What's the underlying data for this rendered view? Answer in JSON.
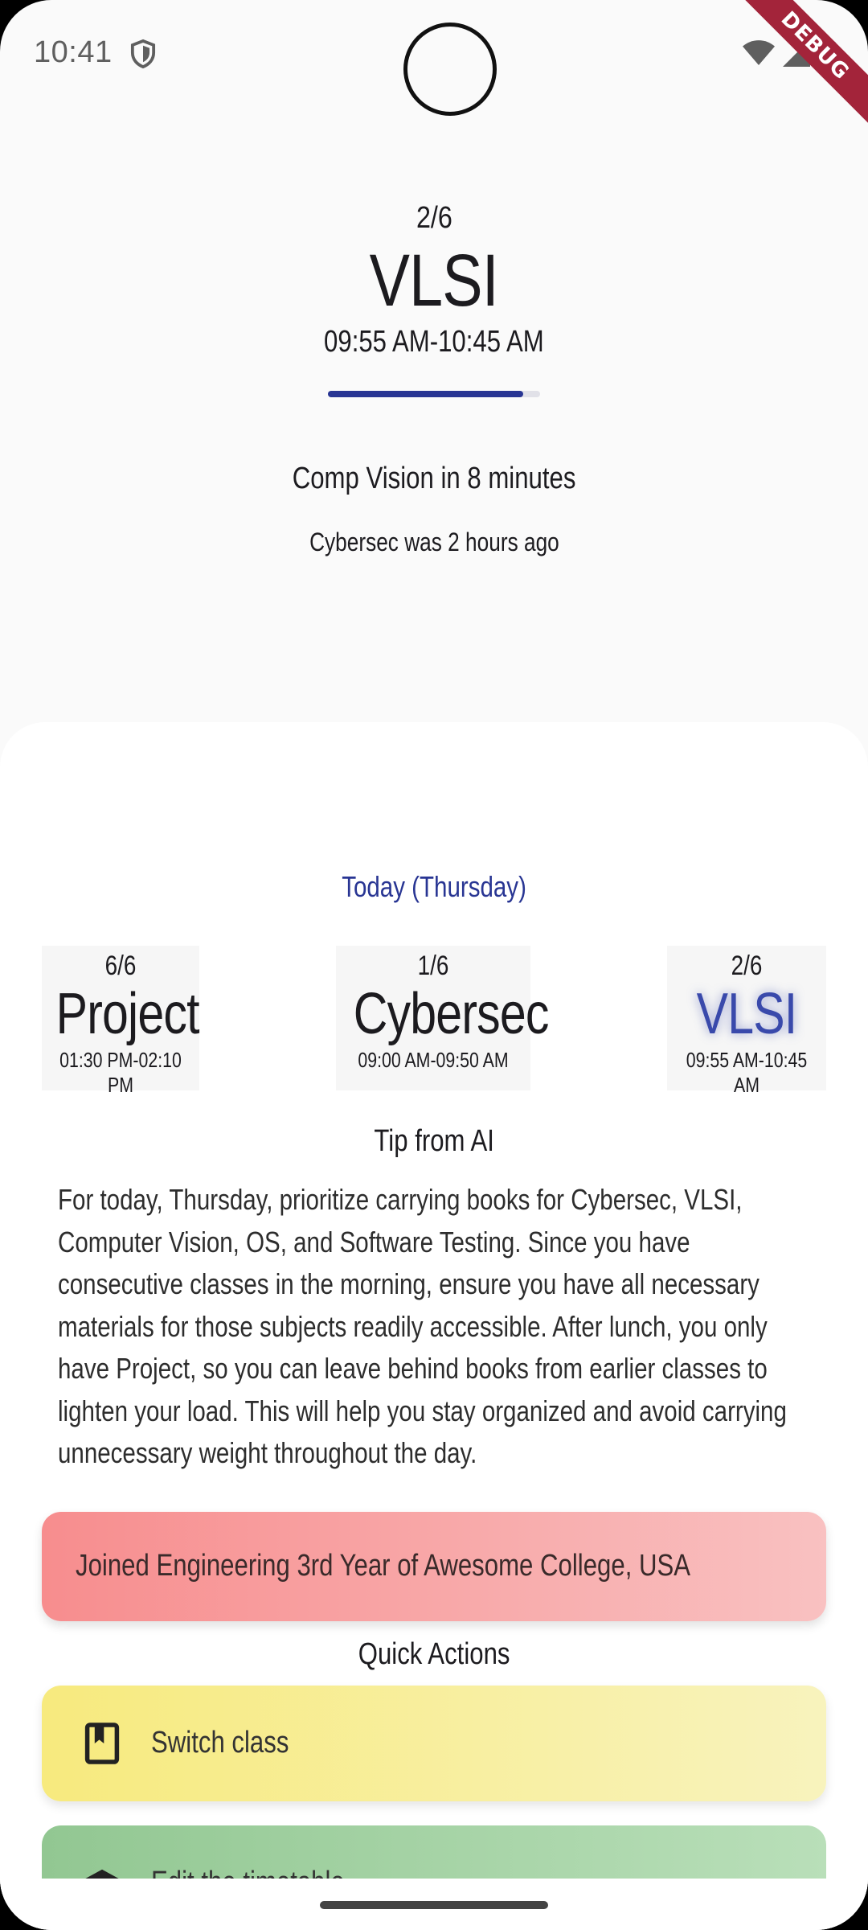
{
  "status_bar": {
    "time": "10:41",
    "debug_label": "DEBUG",
    "icons": [
      "shield-icon",
      "wifi-icon",
      "signal-icon",
      "battery-icon"
    ]
  },
  "current_class": {
    "count": "2/6",
    "name": "VLSI",
    "time": "09:55 AM-10:45 AM",
    "progress": 0.92
  },
  "upcoming": {
    "next": "Comp Vision in 8 minutes",
    "previous": "Cybersec was 2 hours ago"
  },
  "today": {
    "label": "Today (Thursday)",
    "classes": [
      {
        "count": "6/6",
        "name": "Project",
        "time": "01:30 PM-02:10 PM"
      },
      {
        "count": "1/6",
        "name": "Cybersec",
        "time": "09:00 AM-09:50 AM"
      },
      {
        "count": "2/6",
        "name": "VLSI",
        "time": "09:55 AM-10:45 AM",
        "active": true
      }
    ]
  },
  "tip": {
    "title": "Tip from AI",
    "text": "For today, Thursday, prioritize carrying books for Cybersec, VLSI, Computer Vision, OS, and Software Testing. Since you have consecutive classes in the morning, ensure you have all necessary materials for those subjects readily accessible. After lunch, you only have Project, so you can leave behind books from earlier classes to lighten your load. This will help you stay organized and avoid carrying unnecessary weight throughout the day."
  },
  "joined": {
    "text": "Joined Engineering 3rd Year of Awesome College, USA"
  },
  "quick_actions": {
    "title": "Quick Actions",
    "items": [
      {
        "label": "Switch class",
        "icon": "book-icon",
        "color_from": "#f7ea7e",
        "color_to": "#f8f3bd"
      },
      {
        "label": "Edit the timetable",
        "icon": "school-icon",
        "color_from": "#92c792",
        "color_to": "#b9dfb9"
      }
    ]
  },
  "colors": {
    "accent": "#283593",
    "joined_from": "#f78d8e",
    "joined_to": "#f9c1c1"
  }
}
